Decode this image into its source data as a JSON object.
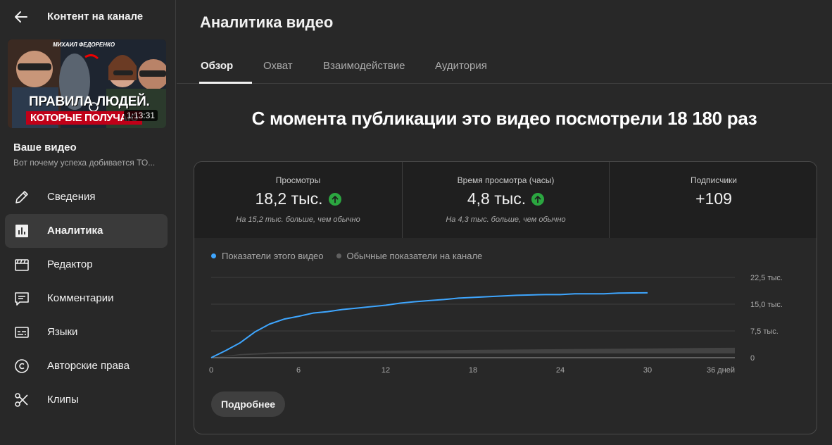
{
  "sidebar": {
    "back_title": "Контент на канале",
    "thumbnail": {
      "author": "МИХАИЛ ФЕДОРЕНКО",
      "line1": "ПРАВИЛА ЛЮДЕЙ.",
      "line2": "КОТОРЫЕ ПОЛУЧАЮ",
      "duration": "1:13:31"
    },
    "your_video": "Ваше видео",
    "video_subtitle": "Вот почему успеха добивается ТО...",
    "items": [
      {
        "label": "Сведения",
        "icon": "pencil-icon"
      },
      {
        "label": "Аналитика",
        "icon": "analytics-icon",
        "active": true
      },
      {
        "label": "Редактор",
        "icon": "clapperboard-icon"
      },
      {
        "label": "Комментарии",
        "icon": "comment-icon"
      },
      {
        "label": "Языки",
        "icon": "subtitles-icon"
      },
      {
        "label": "Авторские права",
        "icon": "copyright-icon"
      },
      {
        "label": "Клипы",
        "icon": "scissors-icon"
      }
    ]
  },
  "main": {
    "title": "Аналитика видео",
    "tabs": [
      {
        "label": "Обзор",
        "active": true
      },
      {
        "label": "Охват"
      },
      {
        "label": "Взаимодействие"
      },
      {
        "label": "Аудитория"
      }
    ],
    "headline": "С момента публикации это видео посмотрели 18 180 раз",
    "metrics": [
      {
        "label": "Просмотры",
        "value": "18,2 тыс.",
        "trend": "up",
        "note": "На 15,2 тыс. больше, чем обычно"
      },
      {
        "label": "Время просмотра (часы)",
        "value": "4,8 тыс.",
        "trend": "up",
        "note": "На 4,3 тыс. больше, чем обычно"
      },
      {
        "label": "Подписчики",
        "value": "+109"
      }
    ],
    "legend": [
      {
        "label": "Показатели этого видео",
        "color": "#3ea6ff"
      },
      {
        "label": "Обычные показатели на канале",
        "color": "#606060"
      }
    ],
    "more_button": "Подробнее"
  },
  "chart_data": {
    "type": "line",
    "x_tick_labels": [
      "0",
      "6",
      "12",
      "18",
      "24",
      "30",
      "36 дней"
    ],
    "x_ticks": [
      0,
      6,
      12,
      18,
      24,
      30,
      36
    ],
    "y_tick_labels": [
      "0",
      "7,5 тыс.",
      "15,0 тыс.",
      "22,5 тыс."
    ],
    "y_ticks": [
      0,
      7500,
      15000,
      22500
    ],
    "xlim": [
      0,
      36
    ],
    "ylim": [
      0,
      22500
    ],
    "series": [
      {
        "name": "Показатели этого видео",
        "color": "#3ea6ff",
        "x": [
          0,
          1,
          2,
          3,
          4,
          5,
          6,
          7,
          8,
          9,
          10,
          11,
          12,
          13,
          14,
          15,
          16,
          17,
          18,
          19,
          20,
          21,
          22,
          23,
          24,
          25,
          26,
          27,
          28,
          29,
          30
        ],
        "y": [
          0,
          2000,
          4200,
          7200,
          9400,
          10800,
          11600,
          12500,
          12900,
          13500,
          13900,
          14300,
          14700,
          15300,
          15700,
          16000,
          16300,
          16700,
          16900,
          17100,
          17300,
          17500,
          17600,
          17700,
          17700,
          17900,
          17900,
          17900,
          18100,
          18150,
          18180
        ]
      },
      {
        "name": "Обычные показатели на канале",
        "color": "#606060",
        "x": [
          0,
          2,
          4,
          6,
          8,
          12,
          18,
          24,
          30,
          36
        ],
        "y_low": [
          0,
          700,
          1000,
          1100,
          1150,
          1200,
          1200,
          1200,
          1200,
          1200
        ],
        "y_high": [
          0,
          1000,
          1450,
          1650,
          1750,
          1950,
          2200,
          2400,
          2600,
          2800
        ]
      }
    ],
    "grid": true
  }
}
